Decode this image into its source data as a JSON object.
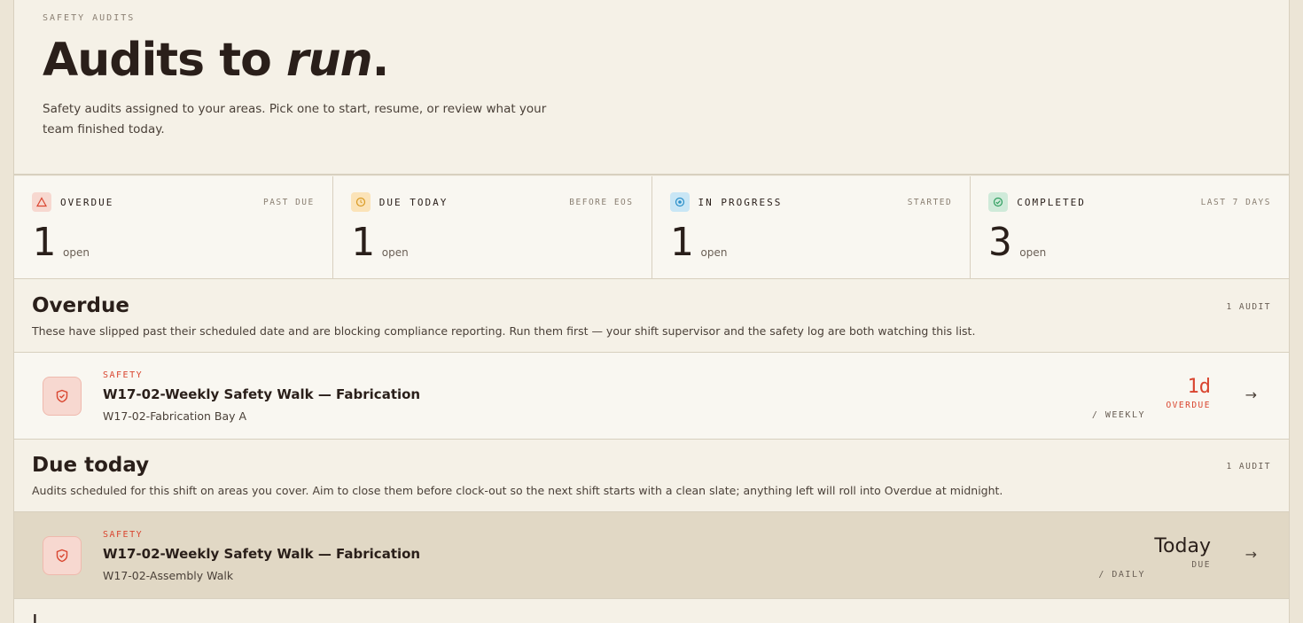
{
  "header": {
    "eyebrow": "SAFETY AUDITS",
    "title_plain": "Audits to ",
    "title_em": "run",
    "title_end": ".",
    "subtitle": "Safety audits assigned to your areas. Pick one to start, resume, or review what your team finished today."
  },
  "stats": [
    {
      "label": "OVERDUE",
      "sub": "PAST DUE",
      "value": "1",
      "unit": "open",
      "color": "#f7d8d0",
      "accent": "#d9452f",
      "icon": "alert-icon"
    },
    {
      "label": "DUE TODAY",
      "sub": "BEFORE EOS",
      "value": "1",
      "unit": "open",
      "color": "#fbe3b8",
      "accent": "#d99a22",
      "icon": "clock-icon"
    },
    {
      "label": "IN PROGRESS",
      "sub": "STARTED",
      "value": "1",
      "unit": "open",
      "color": "#c9e6f5",
      "accent": "#2a8fc9",
      "icon": "progress-icon"
    },
    {
      "label": "COMPLETED",
      "sub": "LAST 7 DAYS",
      "value": "3",
      "unit": "open",
      "color": "#cfead9",
      "accent": "#2f9e5f",
      "icon": "check-icon"
    }
  ],
  "sections": {
    "overdue": {
      "title": "Overdue",
      "count": "1 AUDIT",
      "desc": "These have slipped past their scheduled date and are blocking compliance reporting. Run them first — your shift supervisor and the safety log are both watching this list."
    },
    "due_today": {
      "title": "Due today",
      "count": "1 AUDIT",
      "desc": "Audits scheduled for this shift on areas you cover. Aim to close them before clock-out so the next shift starts with a clean slate; anything left will roll into Overdue at midnight."
    },
    "next_title": "I"
  },
  "rows": {
    "overdue": {
      "tag": "SAFETY",
      "title": "W17-02-Weekly Safety Walk — Fabrication",
      "sub": "W17-02-Fabrication Bay A",
      "freq": "/ WEEKLY",
      "when_big": "1d",
      "when_small": "OVERDUE"
    },
    "due_today": {
      "tag": "SAFETY",
      "title": "W17-02-Weekly Safety Walk — Fabrication",
      "sub": "W17-02-Assembly Walk",
      "freq": "/ DAILY",
      "when_big": "Today",
      "when_small": "DUE"
    }
  },
  "arrow": "→"
}
